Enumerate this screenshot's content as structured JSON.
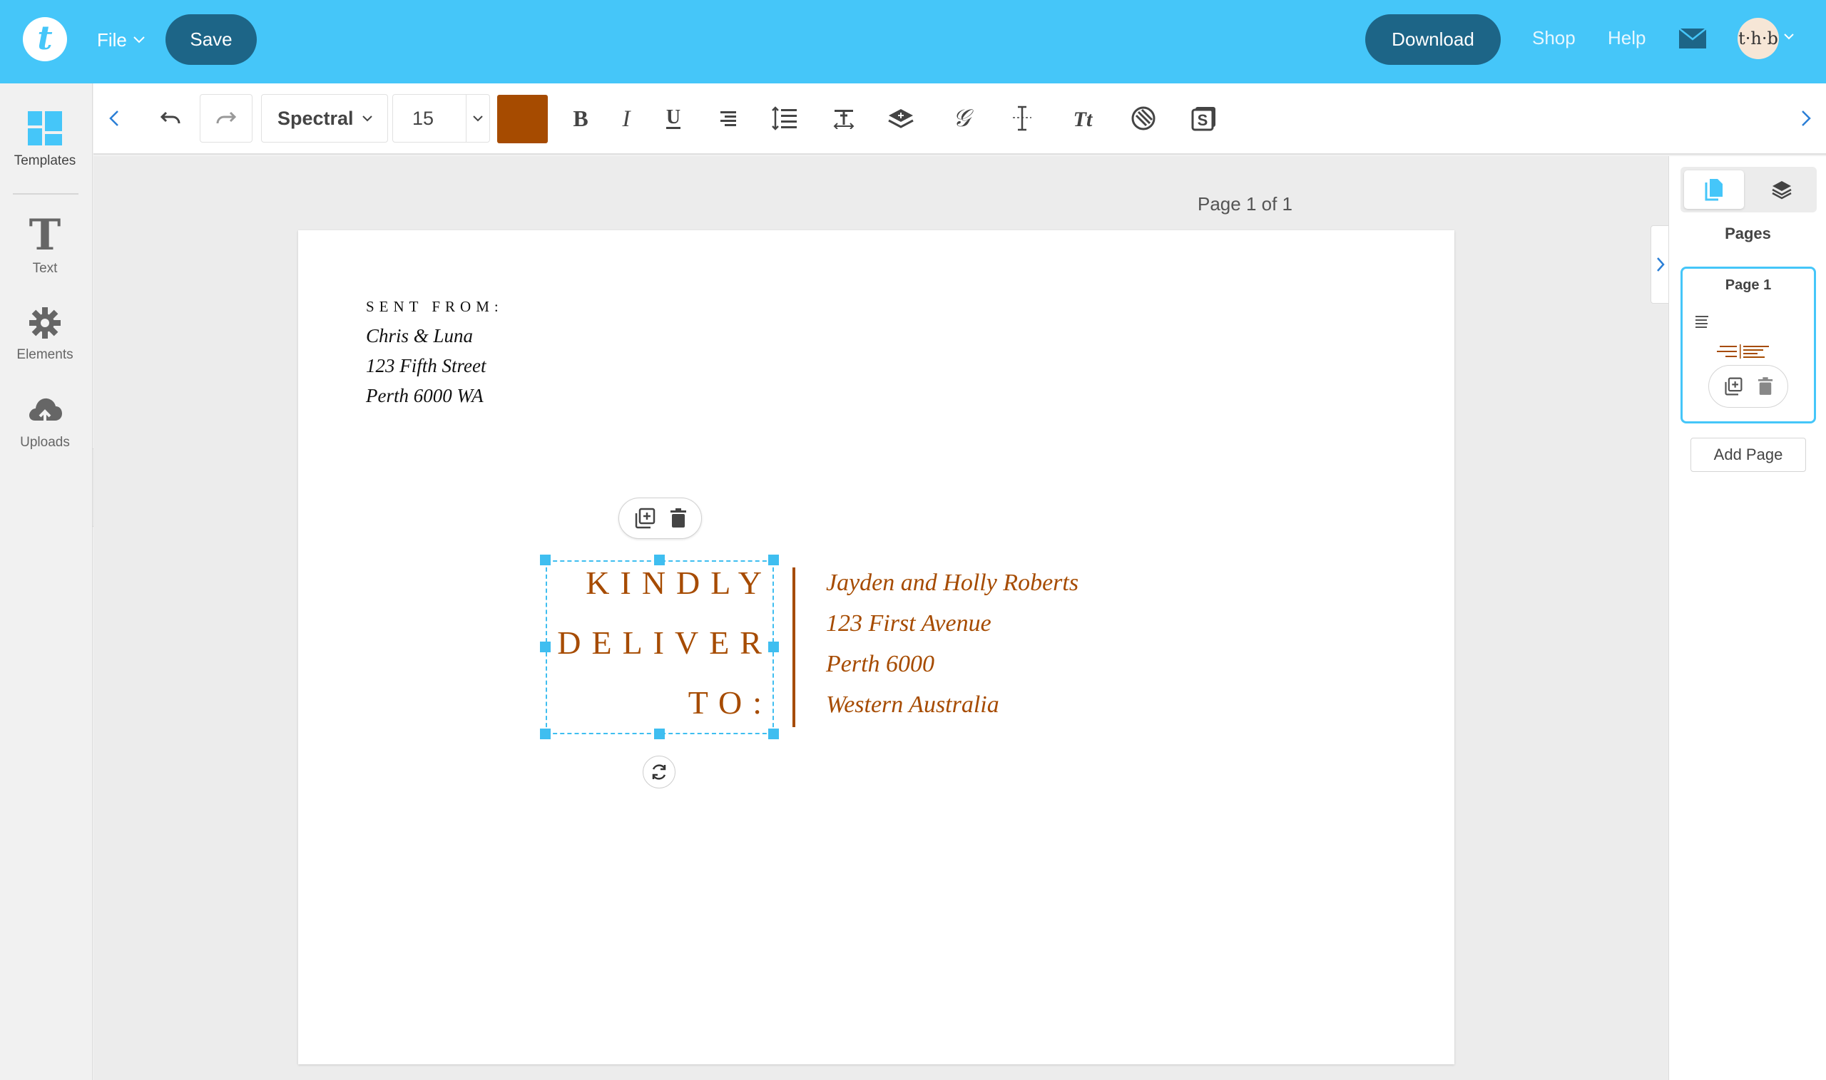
{
  "app": {
    "logo_letter": "t",
    "brand_color": "#45c6f9"
  },
  "topbar": {
    "file_label": "File",
    "save_label": "Save",
    "download_label": "Download",
    "shop_label": "Shop",
    "help_label": "Help",
    "avatar_text": "t·h·b",
    "icons": [
      "mail-icon",
      "chevron-down-icon"
    ]
  },
  "sidebar": {
    "items": [
      {
        "label": "Templates",
        "icon": "templates-icon"
      },
      {
        "label": "Text",
        "icon": "text-icon"
      },
      {
        "label": "Elements",
        "icon": "elements-icon"
      },
      {
        "label": "Uploads",
        "icon": "upload-icon"
      }
    ]
  },
  "toolbar": {
    "font_family": "Spectral",
    "font_size": "15",
    "text_color": "#a64b00",
    "tools": [
      "undo-icon",
      "redo-icon",
      "bold-icon",
      "italic-icon",
      "underline-icon",
      "align-right-icon",
      "line-spacing-icon",
      "letter-spacing-icon",
      "layer-icon",
      "script-font-icon",
      "vertical-spacing-icon",
      "text-case-icon",
      "effects-icon",
      "price-icon"
    ]
  },
  "canvas": {
    "page_indicator": "Page 1 of 1",
    "sent_from": {
      "heading": "SENT FROM:",
      "lines": [
        "Chris & Luna",
        "123 Fifth Street",
        "Perth 6000 WA"
      ]
    },
    "deliver_block": {
      "lines": [
        "KINDLY",
        "DELIVER",
        "TO:"
      ]
    },
    "recipient": {
      "lines": [
        "Jayden and Holly Roberts",
        "123 First Avenue",
        "Perth 6000",
        "Western Australia"
      ]
    },
    "accent_color": "#a64b00"
  },
  "right_panel": {
    "title": "Pages",
    "page_card_label": "Page 1",
    "add_page_label": "Add Page"
  }
}
